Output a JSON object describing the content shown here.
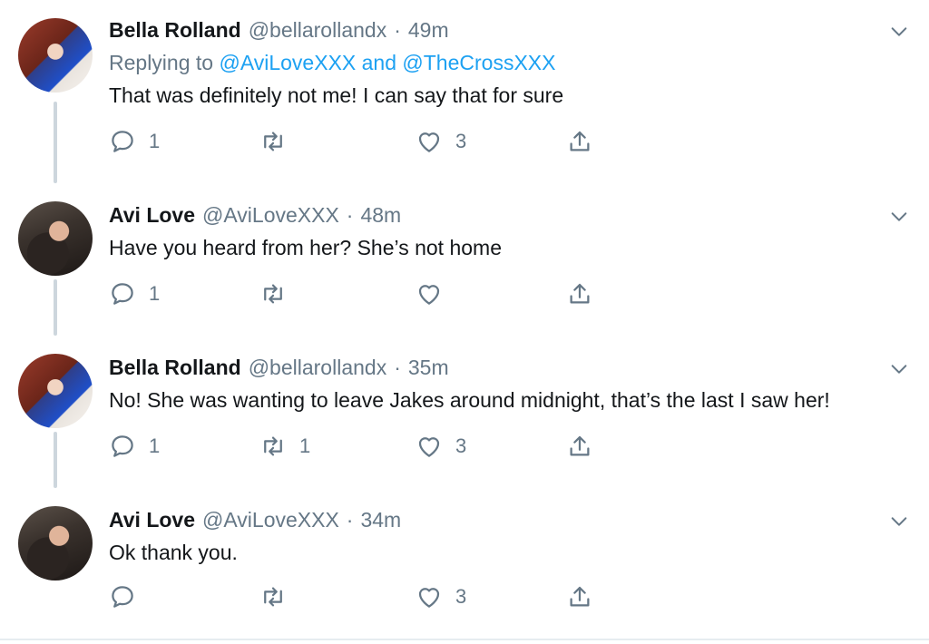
{
  "tweets": [
    {
      "name": "Bella Rolland",
      "handle": "@bellarollandx",
      "separator": "·",
      "time": "49m",
      "replying_prefix": "Replying to",
      "replying_mentions": [
        "@AviLoveXXX",
        "and",
        "@TheCrossXXX"
      ],
      "text": "That was definitely not me! I can say that for sure",
      "reply_count": "1",
      "retweet_count": "",
      "like_count": "3"
    },
    {
      "name": "Avi Love",
      "handle": "@AviLoveXXX",
      "separator": "·",
      "time": "48m",
      "text": "Have you heard from her? She’s not home",
      "reply_count": "1",
      "retweet_count": "",
      "like_count": ""
    },
    {
      "name": "Bella Rolland",
      "handle": "@bellarollandx",
      "separator": "·",
      "time": "35m",
      "text": "No! She was wanting to leave Jakes around midnight, that’s the last I saw her!",
      "reply_count": "1",
      "retweet_count": "1",
      "like_count": "3"
    },
    {
      "name": "Avi Love",
      "handle": "@AviLoveXXX",
      "separator": "·",
      "time": "34m",
      "text": "Ok thank you.",
      "reply_count": "",
      "retweet_count": "",
      "like_count": "3"
    }
  ],
  "icons": {
    "reply": "reply-icon",
    "retweet": "retweet-icon",
    "like": "heart-icon",
    "share": "share-icon",
    "menu": "chevron-down-icon"
  },
  "colors": {
    "text": "#14171a",
    "secondary": "#657786",
    "link": "#1da1f2",
    "thread_line": "#cdd6dd"
  }
}
